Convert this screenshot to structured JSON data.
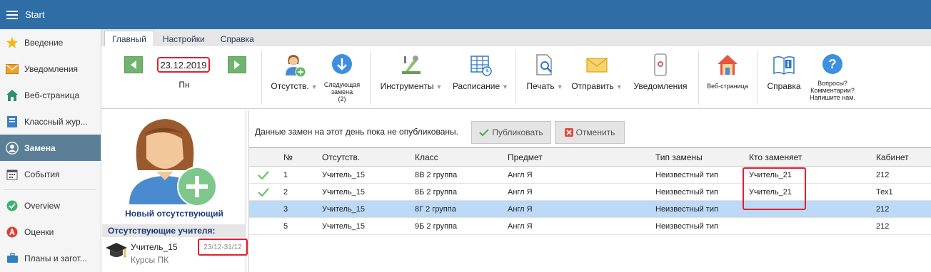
{
  "app": {
    "title": "Start"
  },
  "sidebar": {
    "items": [
      {
        "label": "Введение",
        "icon": "star-icon"
      },
      {
        "label": "Уведомления",
        "icon": "envelope-icon"
      },
      {
        "label": "Веб-страница",
        "icon": "home-icon"
      },
      {
        "label": "Классный жур...",
        "icon": "journal-icon"
      },
      {
        "label": "Замена",
        "icon": "user-icon",
        "active": true
      },
      {
        "label": "События",
        "icon": "calendar-icon"
      },
      {
        "label": "Overview",
        "icon": "check-circle-icon"
      },
      {
        "label": "Оценки",
        "icon": "grade-icon"
      },
      {
        "label": "Планы и загот...",
        "icon": "briefcase-icon"
      }
    ]
  },
  "tabs": [
    {
      "label": "Главный",
      "active": true
    },
    {
      "label": "Настройки"
    },
    {
      "label": "Справка"
    }
  ],
  "ribbon": {
    "date": "23.12.2019",
    "weekday": "Пн",
    "absence": "Отсутств.",
    "next_sub_line1": "Следующая",
    "next_sub_line2": "замена",
    "next_sub_line3": "(2)",
    "tools": "Инструменты",
    "schedule": "Расписание",
    "print": "Печать",
    "send": "Отправить",
    "notifications": "Уведомления",
    "webpage": "Веб-страница",
    "help": "Справка",
    "questions_line1": "Вопросы?",
    "questions_line2": "Комментарии?",
    "questions_line3": "Напишите нам."
  },
  "left_panel": {
    "new_absent_label": "Новый отсутствующий",
    "absent_header": "Отсутствующие учителя:",
    "absent": {
      "name": "Учитель_15",
      "sub": "Курсы ПК",
      "range": "23/12-31/12"
    }
  },
  "main": {
    "notice": "Данные замен на этот день пока не опубликованы.",
    "publish_label": "Публиковать",
    "cancel_label": "Отменить",
    "columns": [
      "№",
      "Отсутств.",
      "Класс",
      "Предмет",
      "Тип замены",
      "Кто заменяет",
      "Кабинет"
    ],
    "rows": [
      {
        "checked": true,
        "no": "1",
        "absent": "Учитель_15",
        "class": "8В 2 группа",
        "subject": "Англ Я",
        "type": "Неизвестный тип",
        "sub": "Учитель_21",
        "room": "212"
      },
      {
        "checked": true,
        "no": "2",
        "absent": "Учитель_15",
        "class": "8Б 2 группа",
        "subject": "Англ Я",
        "type": "Неизвестный тип",
        "sub": "Учитель_21",
        "room": "Тех1"
      },
      {
        "checked": false,
        "selected": true,
        "no": "3",
        "absent": "Учитель_15",
        "class": "8Г 2 группа",
        "subject": "Англ Я",
        "type": "Неизвестный тип",
        "sub": "",
        "room": "212"
      },
      {
        "checked": false,
        "no": "5",
        "absent": "Учитель_15",
        "class": "9Б 2 группа",
        "subject": "Англ Я",
        "type": "Неизвестный тип",
        "sub": "",
        "room": "212"
      }
    ]
  },
  "colors": {
    "topbar": "#2f6da6",
    "active_sidebar": "#5a7f97",
    "highlight_red": "#e0202d",
    "selected_row": "#bcd9f5"
  }
}
